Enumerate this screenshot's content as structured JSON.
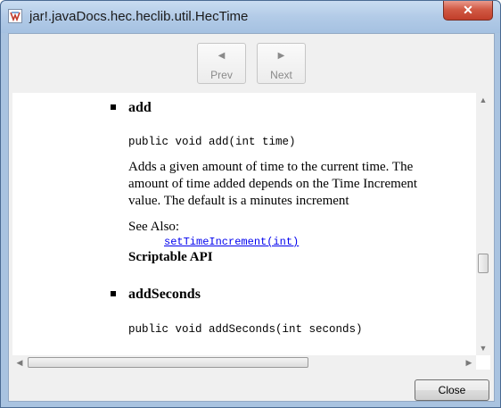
{
  "window": {
    "title": "jar!.javaDocs.hec.heclib.util.HecTime",
    "app_icon": "java-app-icon",
    "close_icon": "close-icon"
  },
  "toolbar": {
    "prev": {
      "label": "Prev",
      "icon": "triangle-left-icon",
      "enabled": false
    },
    "next": {
      "label": "Next",
      "icon": "triangle-right-icon",
      "enabled": false
    }
  },
  "doc": {
    "methods": [
      {
        "name": "add",
        "signature": "public void add(int time)",
        "description": "Adds a given amount of time to the current time. The amount of time added depends on the Time Increment value. The default is a minutes increment",
        "see_also_label": "See Also:",
        "see_also_link": "setTimeIncrement(int)",
        "note": "Scriptable API"
      },
      {
        "name": "addSeconds",
        "signature": "public void addSeconds(int seconds)"
      }
    ]
  },
  "footer": {
    "close_label": "Close"
  },
  "colors": {
    "link": "#0000ee",
    "title_bar": "#b2cbe7",
    "close_x": "#c13e2a"
  }
}
